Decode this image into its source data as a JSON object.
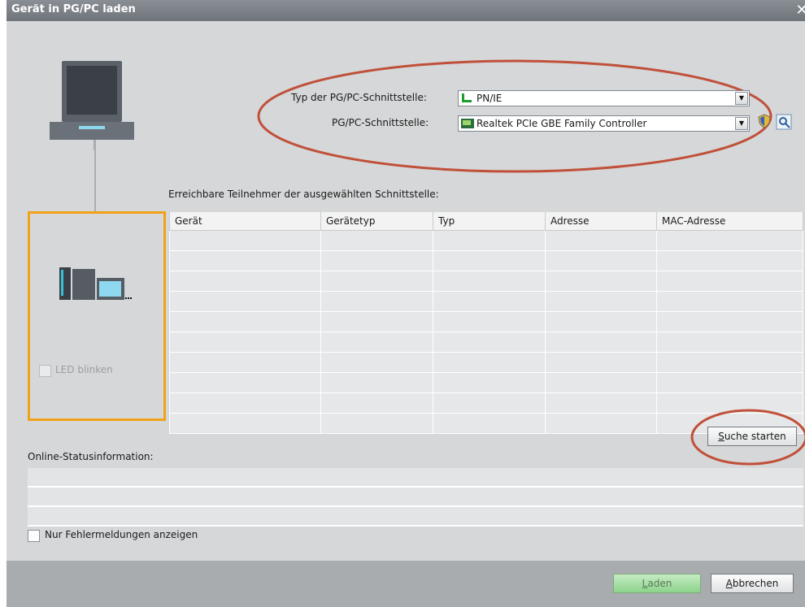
{
  "window": {
    "title": "Gerät in PG/PC laden",
    "close_glyph": "✕"
  },
  "interface": {
    "type_label": "Typ der PG/PC-Schnittstelle:",
    "type_value": "PN/IE",
    "interface_label": "PG/PC-Schnittstelle:",
    "interface_value": "Realtek PCIe GBE Family Controller"
  },
  "reachable": {
    "heading": "Erreichbare Teilnehmer der ausgewählten Schnittstelle:",
    "columns": [
      "Gerät",
      "Gerätetyp",
      "Typ",
      "Adresse",
      "MAC-Adresse"
    ],
    "row_count": 10
  },
  "led_blink_label": "LED blinken",
  "search_button": {
    "mnemonic": "S",
    "rest": "uche starten"
  },
  "status": {
    "heading": "Online-Statusinformation:",
    "only_errors_label": "Nur Fehlermeldungen anzeigen"
  },
  "footer": {
    "load_button": {
      "mnemonic": "L",
      "rest": "aden"
    },
    "cancel_button": {
      "mnemonic": "A",
      "rest": "bbrechen"
    }
  },
  "colors": {
    "highlight_orange": "#f0a21a",
    "annotation_red": "#c0503a",
    "load_green": "#8cd38a"
  }
}
